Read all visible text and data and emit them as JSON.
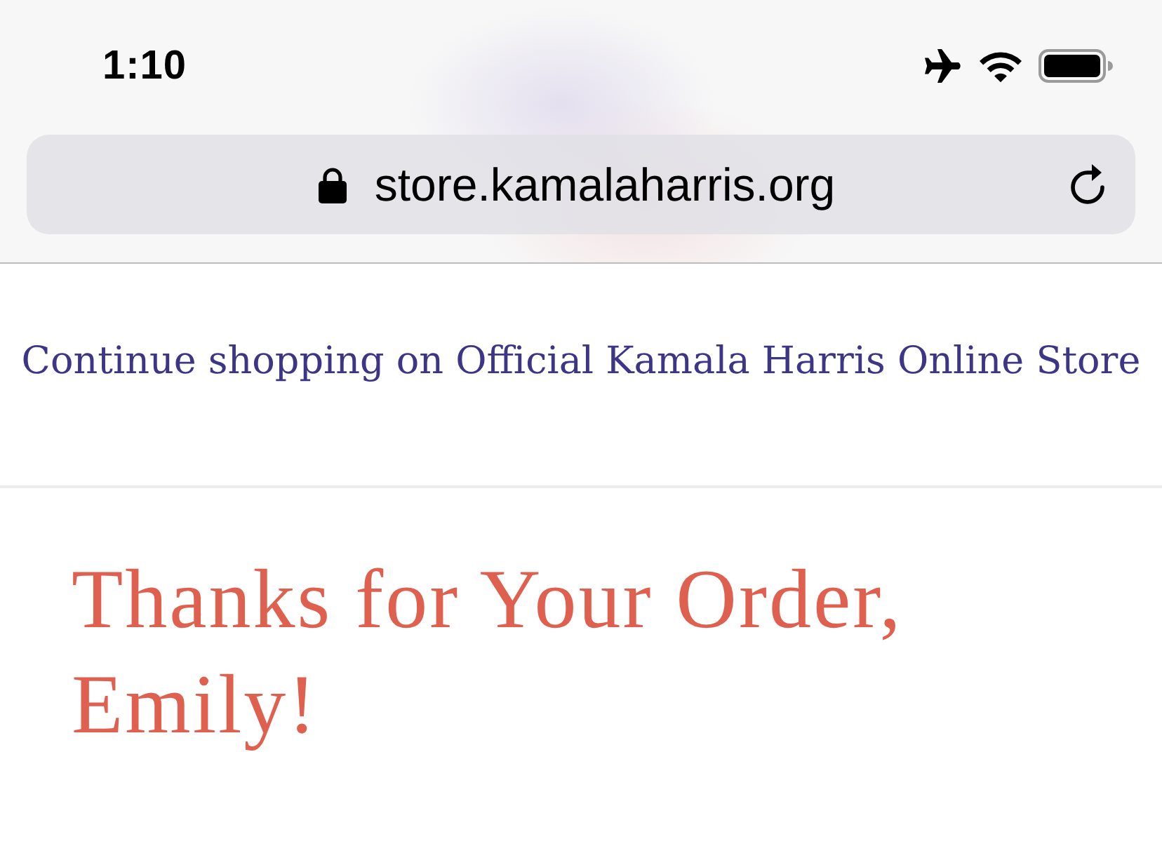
{
  "status_bar": {
    "time": "1:10"
  },
  "address_bar": {
    "url": "store.kamalaharris.org",
    "secure": true
  },
  "page": {
    "continue_link": "Continue shopping on Official Kamala Harris Online Store",
    "heading": "Thanks for Your Order, Emily!"
  }
}
